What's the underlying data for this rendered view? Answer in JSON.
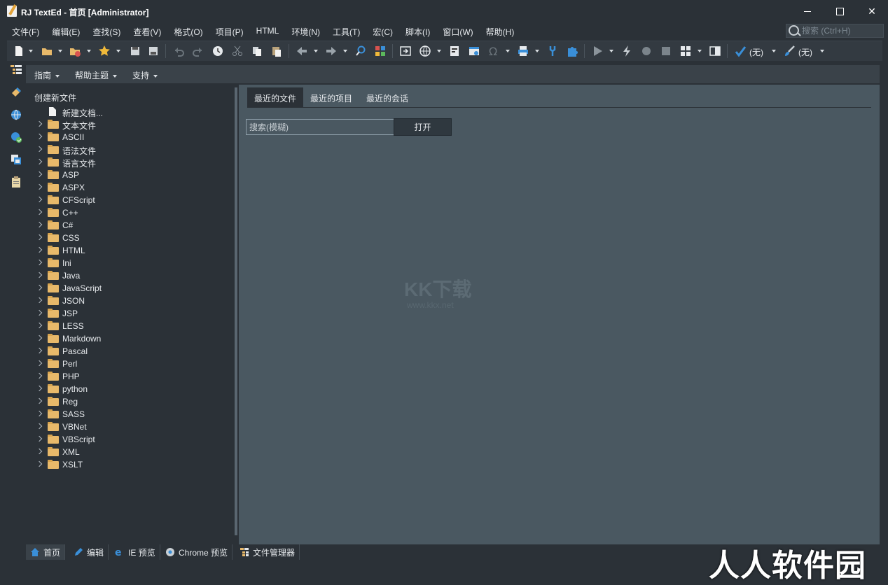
{
  "window": {
    "title": "RJ TextEd - 首页 [Administrator]"
  },
  "menu": [
    "文件(F)",
    "编辑(E)",
    "查找(S)",
    "查看(V)",
    "格式(O)",
    "项目(P)",
    "HTML",
    "环境(N)",
    "工具(T)",
    "宏(C)",
    "脚本(I)",
    "窗口(W)",
    "帮助(H)"
  ],
  "global_search": {
    "placeholder": "搜索 (Ctrl+H)"
  },
  "toolbar": {
    "highlighter_value": "(无)",
    "brush_value": "(无)"
  },
  "helpbar": {
    "items": [
      "指南",
      "帮助主题",
      "支持"
    ]
  },
  "tree": {
    "title": "创建新文件",
    "new_doc": "新建文档...",
    "folders": [
      "文本文件",
      "ASCII",
      "语法文件",
      "语言文件",
      "ASP",
      "ASPX",
      "CFScript",
      "C++",
      "C#",
      "CSS",
      "HTML",
      "Ini",
      "Java",
      "JavaScript",
      "JSON",
      "JSP",
      "LESS",
      "Markdown",
      "Pascal",
      "Perl",
      "PHP",
      "python",
      "Reg",
      "SASS",
      "VBNet",
      "VBScript",
      "XML",
      "XSLT"
    ]
  },
  "recent": {
    "tabs": [
      "最近的文件",
      "最近的项目",
      "最近的会话"
    ],
    "active_tab": 0,
    "search_placeholder": "搜索(模糊)",
    "open_label": "打开"
  },
  "bottom_tabs": [
    "首页",
    "编辑",
    "IE 预览",
    "Chrome 预览",
    "文件管理器"
  ],
  "watermarks": {
    "center": "KK下载",
    "center_url": "www.kkx.net",
    "corner": "人人软件园"
  },
  "colors": {
    "background": "#2b3137",
    "content": "#4a5861",
    "folder": "#e8b96a",
    "accent_blue": "#3a8fd8"
  }
}
